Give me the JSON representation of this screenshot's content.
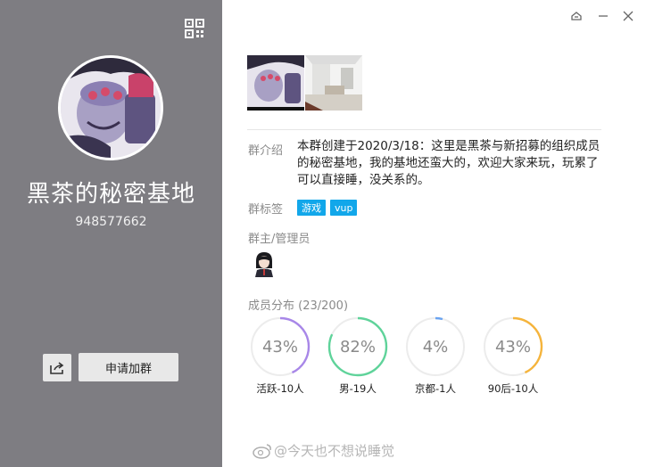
{
  "group": {
    "name": "黑茶的秘密基地",
    "id": "948577662",
    "join_label": "申请加群"
  },
  "intro": {
    "label": "群介绍",
    "text": "本群创建于2020/3/18：这里是黑茶与新招募的组织成员的秘密基地，我的基地还蛮大的，欢迎大家来玩，玩累了可以直接睡，没关系的。"
  },
  "tags": {
    "label": "群标签",
    "items": [
      "游戏",
      "vup"
    ]
  },
  "admins": {
    "label": "群主/管理员"
  },
  "distribution": {
    "label": "成员分布 (23/200)",
    "stats": [
      {
        "percent": "43%",
        "fraction": 0.43,
        "label": "活跃-10人",
        "color": "#a887e8"
      },
      {
        "percent": "82%",
        "fraction": 0.82,
        "label": "男-19人",
        "color": "#5fd39a"
      },
      {
        "percent": "4%",
        "fraction": 0.04,
        "label": "京都-1人",
        "color": "#6aa3f0"
      },
      {
        "percent": "43%",
        "fraction": 0.43,
        "label": "90后-10人",
        "color": "#f5b43c"
      }
    ]
  },
  "watermark": "@今天也不想说睡觉"
}
